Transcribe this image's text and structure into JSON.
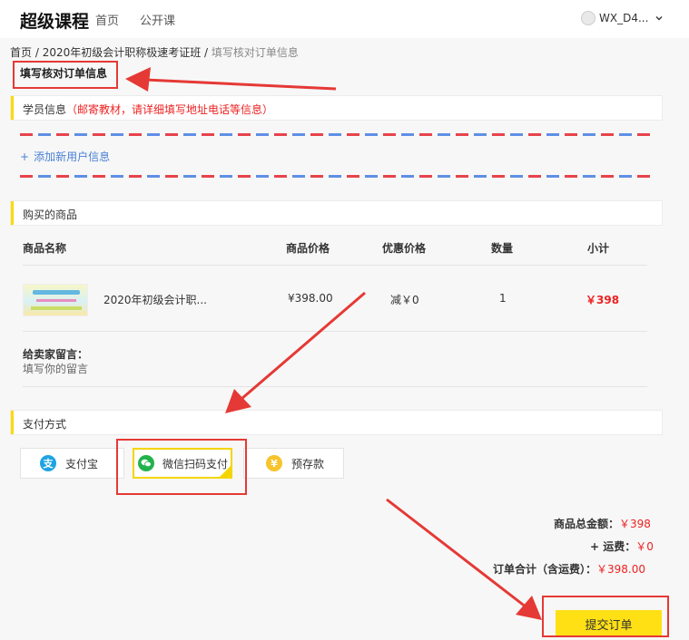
{
  "header": {
    "logo": "超级课程",
    "nav": [
      "首页",
      "公开课"
    ],
    "user_name": "WX_D4..."
  },
  "breadcrumb": {
    "home": "首页",
    "sep": " / ",
    "course": "2020年初级会计职称极速考证班",
    "current": "填写核对订单信息"
  },
  "page_title": "填写核对订单信息",
  "student_section": {
    "label": "学员信息",
    "note": "（邮寄教材，请详细填写地址电话等信息）",
    "add_user": "添加新用户信息"
  },
  "goods_section": {
    "label": "购买的商品",
    "columns": [
      "商品名称",
      "商品价格",
      "优惠价格",
      "数量",
      "小计"
    ],
    "rows": [
      {
        "name": "2020年初级会计职...",
        "price": "¥398.00",
        "discount": "减￥0",
        "qty": "1",
        "subtotal": "￥398"
      }
    ],
    "message_label": "给卖家留言：",
    "message_placeholder": "填写你的留言"
  },
  "payment_section": {
    "label": "支付方式",
    "options": [
      {
        "label": "支付宝",
        "icon": "alipay-icon",
        "color": "#1ea3e3"
      },
      {
        "label": "微信扫码支付",
        "icon": "wechat-icon",
        "color": "#22b24c",
        "selected": true
      },
      {
        "label": "预存款",
        "icon": "yen-coin-icon",
        "color": "#f7c42c"
      }
    ]
  },
  "summary": {
    "goods_total_label": "商品总金额：",
    "goods_total": "￥398",
    "shipping_label": "+ 运费：",
    "shipping": "￥0",
    "order_total_label": "订单合计（含运费）：",
    "order_total": "￥398.00"
  },
  "submit_label": "提交订单",
  "colors": {
    "accent": "#ffe015",
    "price_red": "#e22222",
    "annotation_red": "#e53935",
    "link_blue": "#4a80d4"
  }
}
